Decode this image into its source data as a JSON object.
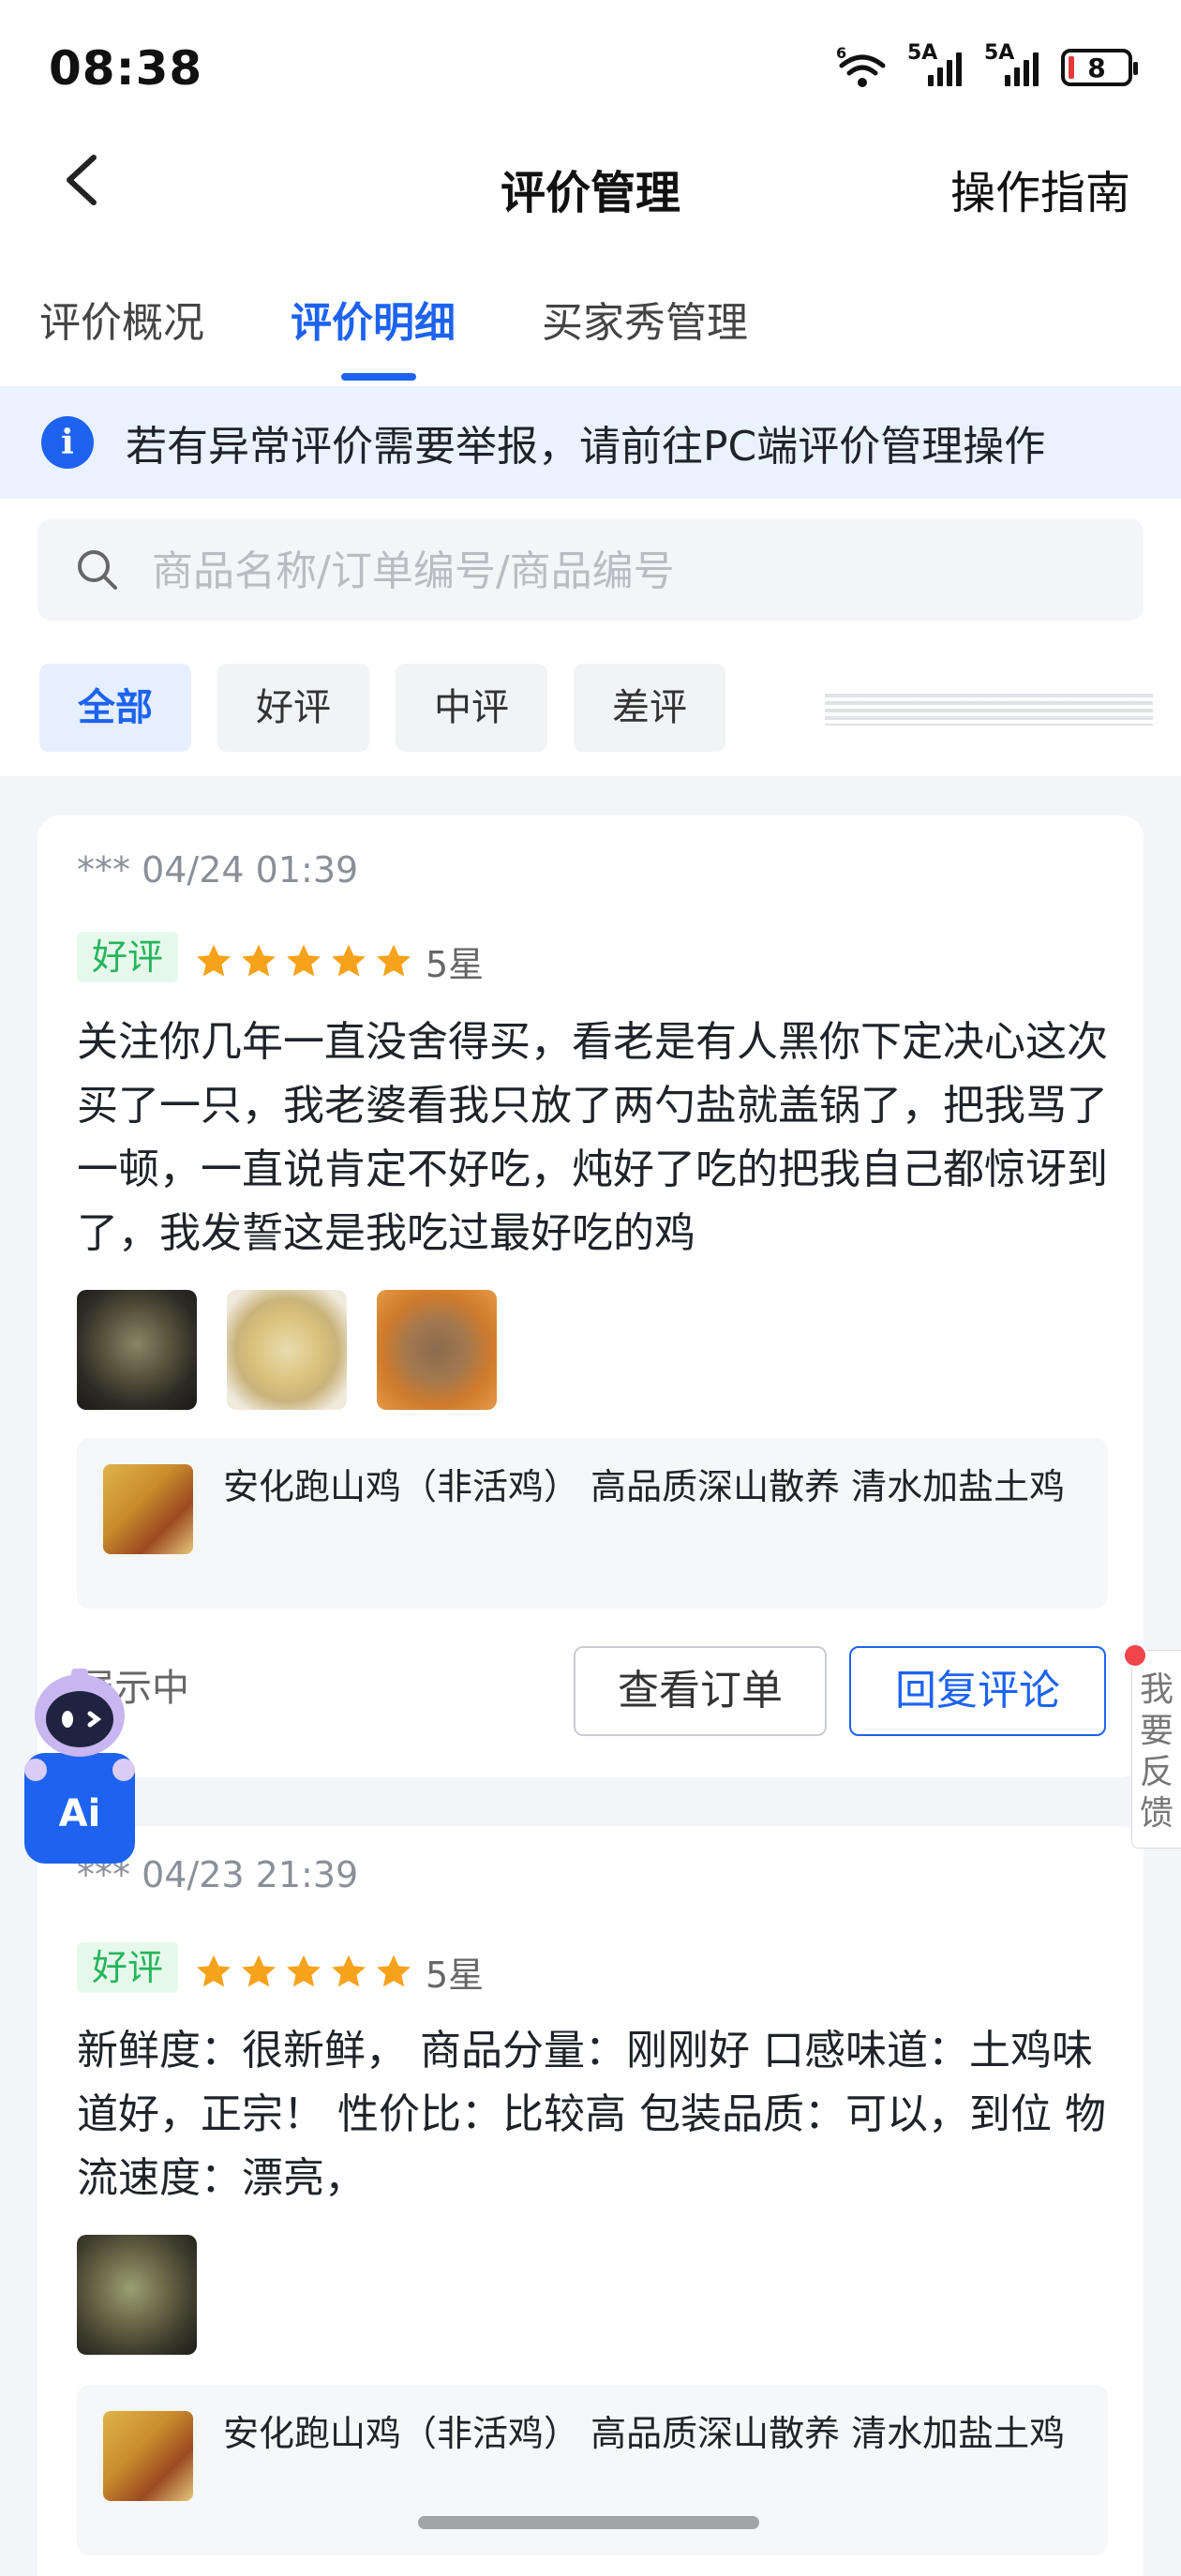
{
  "status_bar": {
    "time": "08:38",
    "battery": "8",
    "signal1": "5A",
    "signal2": "5A",
    "wifi": "6"
  },
  "nav": {
    "title": "评价管理",
    "guide": "操作指南"
  },
  "tabs": [
    {
      "label": "评价概况"
    },
    {
      "label": "评价明细"
    },
    {
      "label": "买家秀管理"
    }
  ],
  "notice": {
    "text": "若有异常评价需要举报，请前往PC端评价管理操作"
  },
  "search": {
    "placeholder": "商品名称/订单编号/商品编号"
  },
  "filters": [
    {
      "label": "全部"
    },
    {
      "label": "好评"
    },
    {
      "label": "中评"
    },
    {
      "label": "差评"
    }
  ],
  "reviews": [
    {
      "user_time": "*** 04/24 01:39",
      "badge": "好评",
      "stars": 5,
      "stars_label": "5星",
      "content": "关注你几年一直没舍得买，看老是有人黑你下定决心这次买了一只，我老婆看我只放了两勺盐就盖锅了，把我骂了一顿，一直说肯定不好吃，炖好了吃的把我自己都惊讶到了，我发誓这是我吃过最好吃的鸡",
      "product": "安化跑山鸡（非活鸡） 高品质深山散养 清水加盐土鸡",
      "status": "展示中",
      "btn_order": "查看订单",
      "btn_reply": "回复评论"
    },
    {
      "user_time": "*** 04/23 21:39",
      "badge": "好评",
      "stars": 5,
      "stars_label": "5星",
      "content": "新鲜度：很新鲜， 商品分量：刚刚好 口感味道：土鸡味道好，正宗！ 性价比：比较高 包装品质：可以，到位 物流速度：漂亮，",
      "product": "安化跑山鸡（非活鸡） 高品质深山散养 清水加盐土鸡"
    }
  ],
  "feedback": {
    "label": "我要反馈"
  },
  "ai_assistant": {
    "label": "Ai"
  },
  "colors": {
    "accent": "#1d63f0",
    "good": "#26b55a",
    "star": "#f7a21b"
  }
}
